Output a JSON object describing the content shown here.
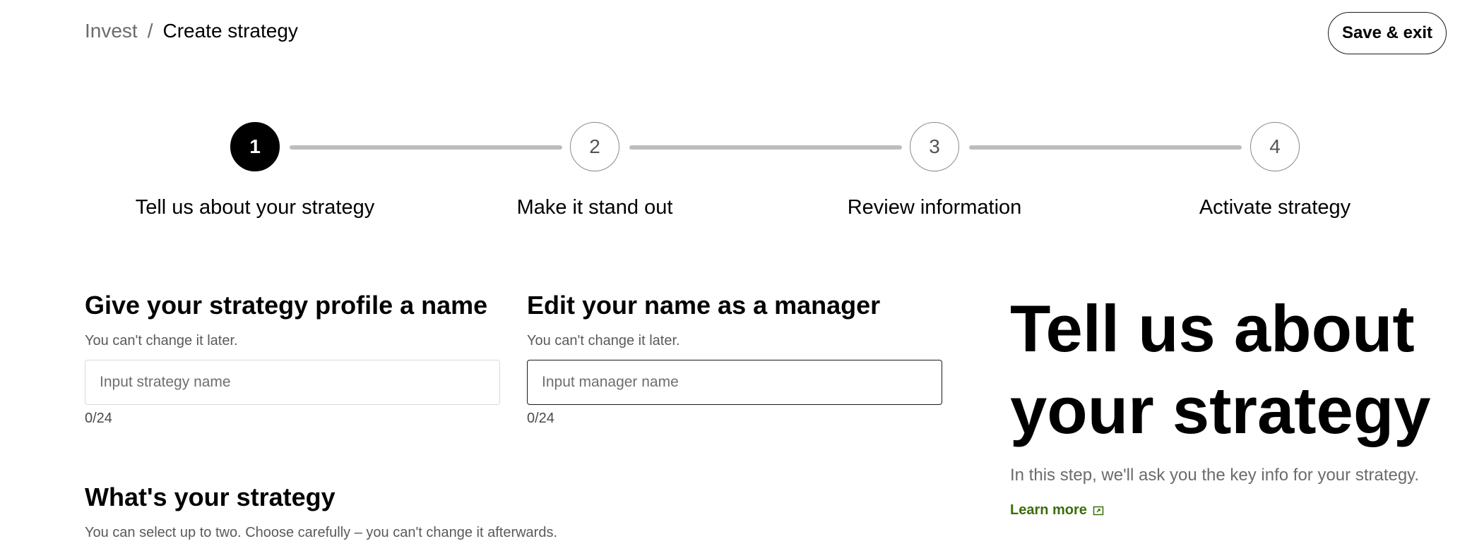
{
  "header": {
    "breadcrumb_parent": "Invest",
    "breadcrumb_separator": "/",
    "breadcrumb_current": "Create strategy",
    "save_exit_label": "Save & exit"
  },
  "stepper": {
    "current_step": 1,
    "steps": [
      {
        "number": "1",
        "label": "Tell us about your strategy"
      },
      {
        "number": "2",
        "label": "Make it stand out"
      },
      {
        "number": "3",
        "label": "Review information"
      },
      {
        "number": "4",
        "label": "Activate strategy"
      }
    ]
  },
  "form": {
    "strategy_name": {
      "title": "Give your strategy profile a name",
      "hint": "You can't change it later.",
      "placeholder": "Input strategy name",
      "value": "",
      "counter": "0/24"
    },
    "manager_name": {
      "title": "Edit your name as a manager",
      "hint": "You can't change it later.",
      "placeholder": "Input manager name",
      "value": "",
      "counter": "0/24"
    },
    "strategy_type": {
      "title": "What's your strategy",
      "hint": "You can select up to two. Choose carefully – you can't change it afterwards."
    }
  },
  "aside": {
    "title": "Tell us about your strategy",
    "description": "In this step, we'll ask you the key info for your strategy.",
    "learn_more": "Learn more",
    "link_color": "#3b6e0a",
    "link_icon": "external-link-icon"
  }
}
